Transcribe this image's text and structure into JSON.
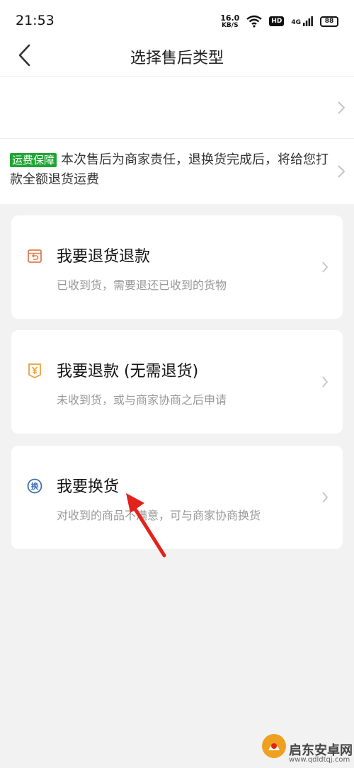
{
  "status_bar": {
    "time": "21:53",
    "speed_value": "16.0",
    "speed_unit": "KB/S",
    "hd": "HD",
    "network": "4G",
    "battery": "88"
  },
  "nav": {
    "title": "选择售后类型"
  },
  "notice": {
    "badge": "运费保障",
    "text": "本次售后为商家责任，退换货完成后，将给您打款全额退货运费"
  },
  "options": [
    {
      "title": "我要退货退款",
      "subtitle": "已收到货，需要退还已收到的货物",
      "icon": "return-box-icon",
      "icon_color": "#e07a4f"
    },
    {
      "title": "我要退款 (无需退货)",
      "subtitle": "未收到货，或与商家协商之后申请",
      "icon": "yen-tag-icon",
      "icon_color": "#e8a13a"
    },
    {
      "title": "我要换货",
      "subtitle": "对收到的商品不满意，可与商家协商换货",
      "icon": "exchange-badge-icon",
      "icon_color": "#3f6fb5",
      "icon_glyph": "换"
    }
  ],
  "watermark": {
    "text": "启东安卓网",
    "url": "www.qdldtqj.com"
  },
  "colors": {
    "accent_green": "#1ea633",
    "annotation_red": "#e3231b"
  }
}
